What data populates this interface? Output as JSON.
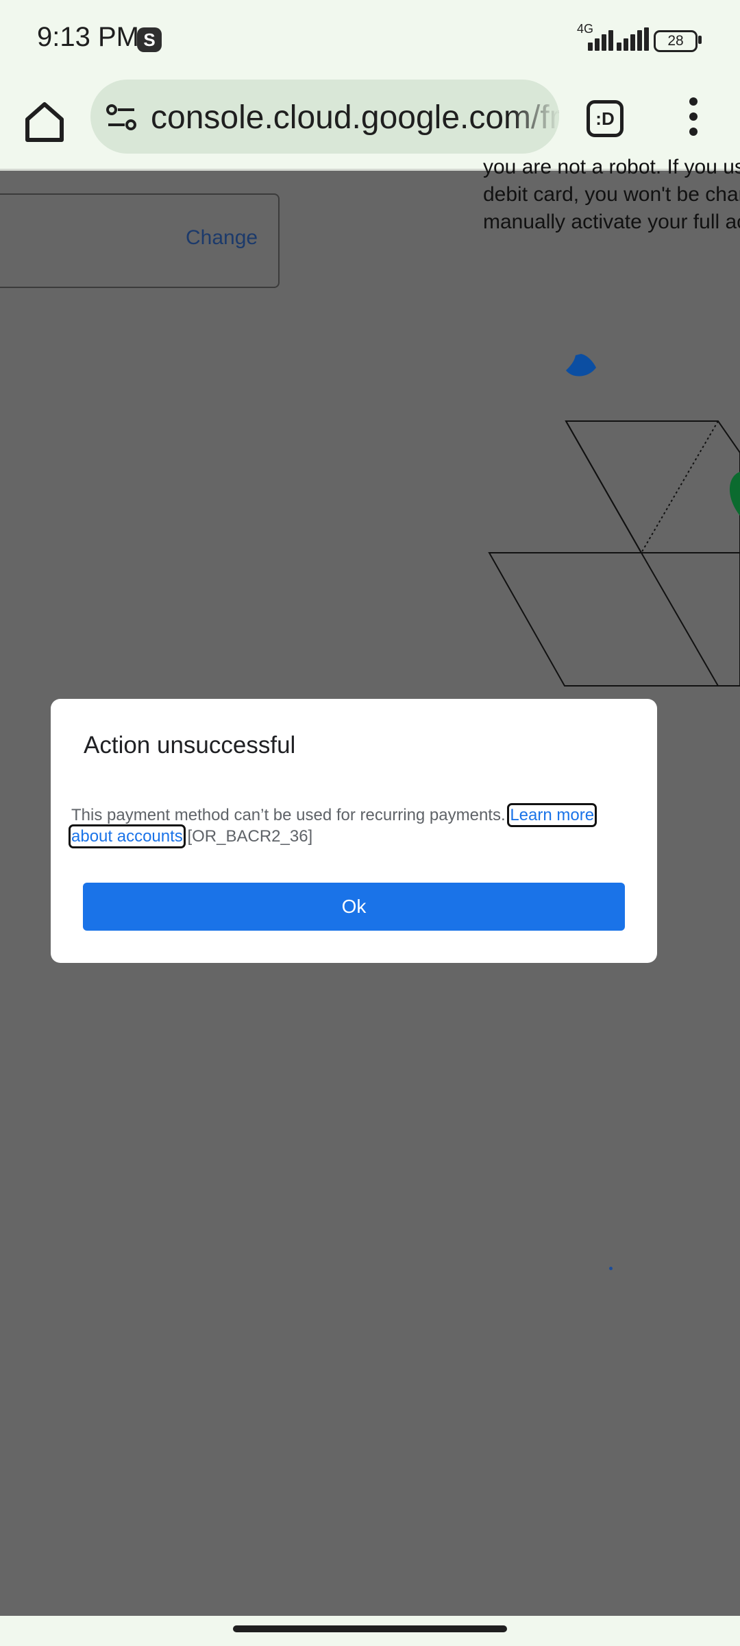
{
  "status_bar": {
    "time": "9:13 PM",
    "app_badge": "S",
    "network": "4G",
    "battery": "28"
  },
  "browser": {
    "url": "console.cloud.google.com/fre",
    "tab_switcher_label": ":D"
  },
  "background_page": {
    "change_link": "Change",
    "text_lines": [
      "you are not a robot. If you us",
      "debit card, you won't be charg",
      "manually activate your full ac"
    ]
  },
  "dialog": {
    "title": "Action unsuccessful",
    "message": "This payment method can’t be used for recurring payments. ",
    "link_text": "Learn more about accounts",
    "error_code": " [OR_BACR2_36]",
    "ok_label": "Ok"
  },
  "colors": {
    "primary": "#1a73e8",
    "scrim": "#666666",
    "chrome_bg": "#f1f8ee"
  }
}
